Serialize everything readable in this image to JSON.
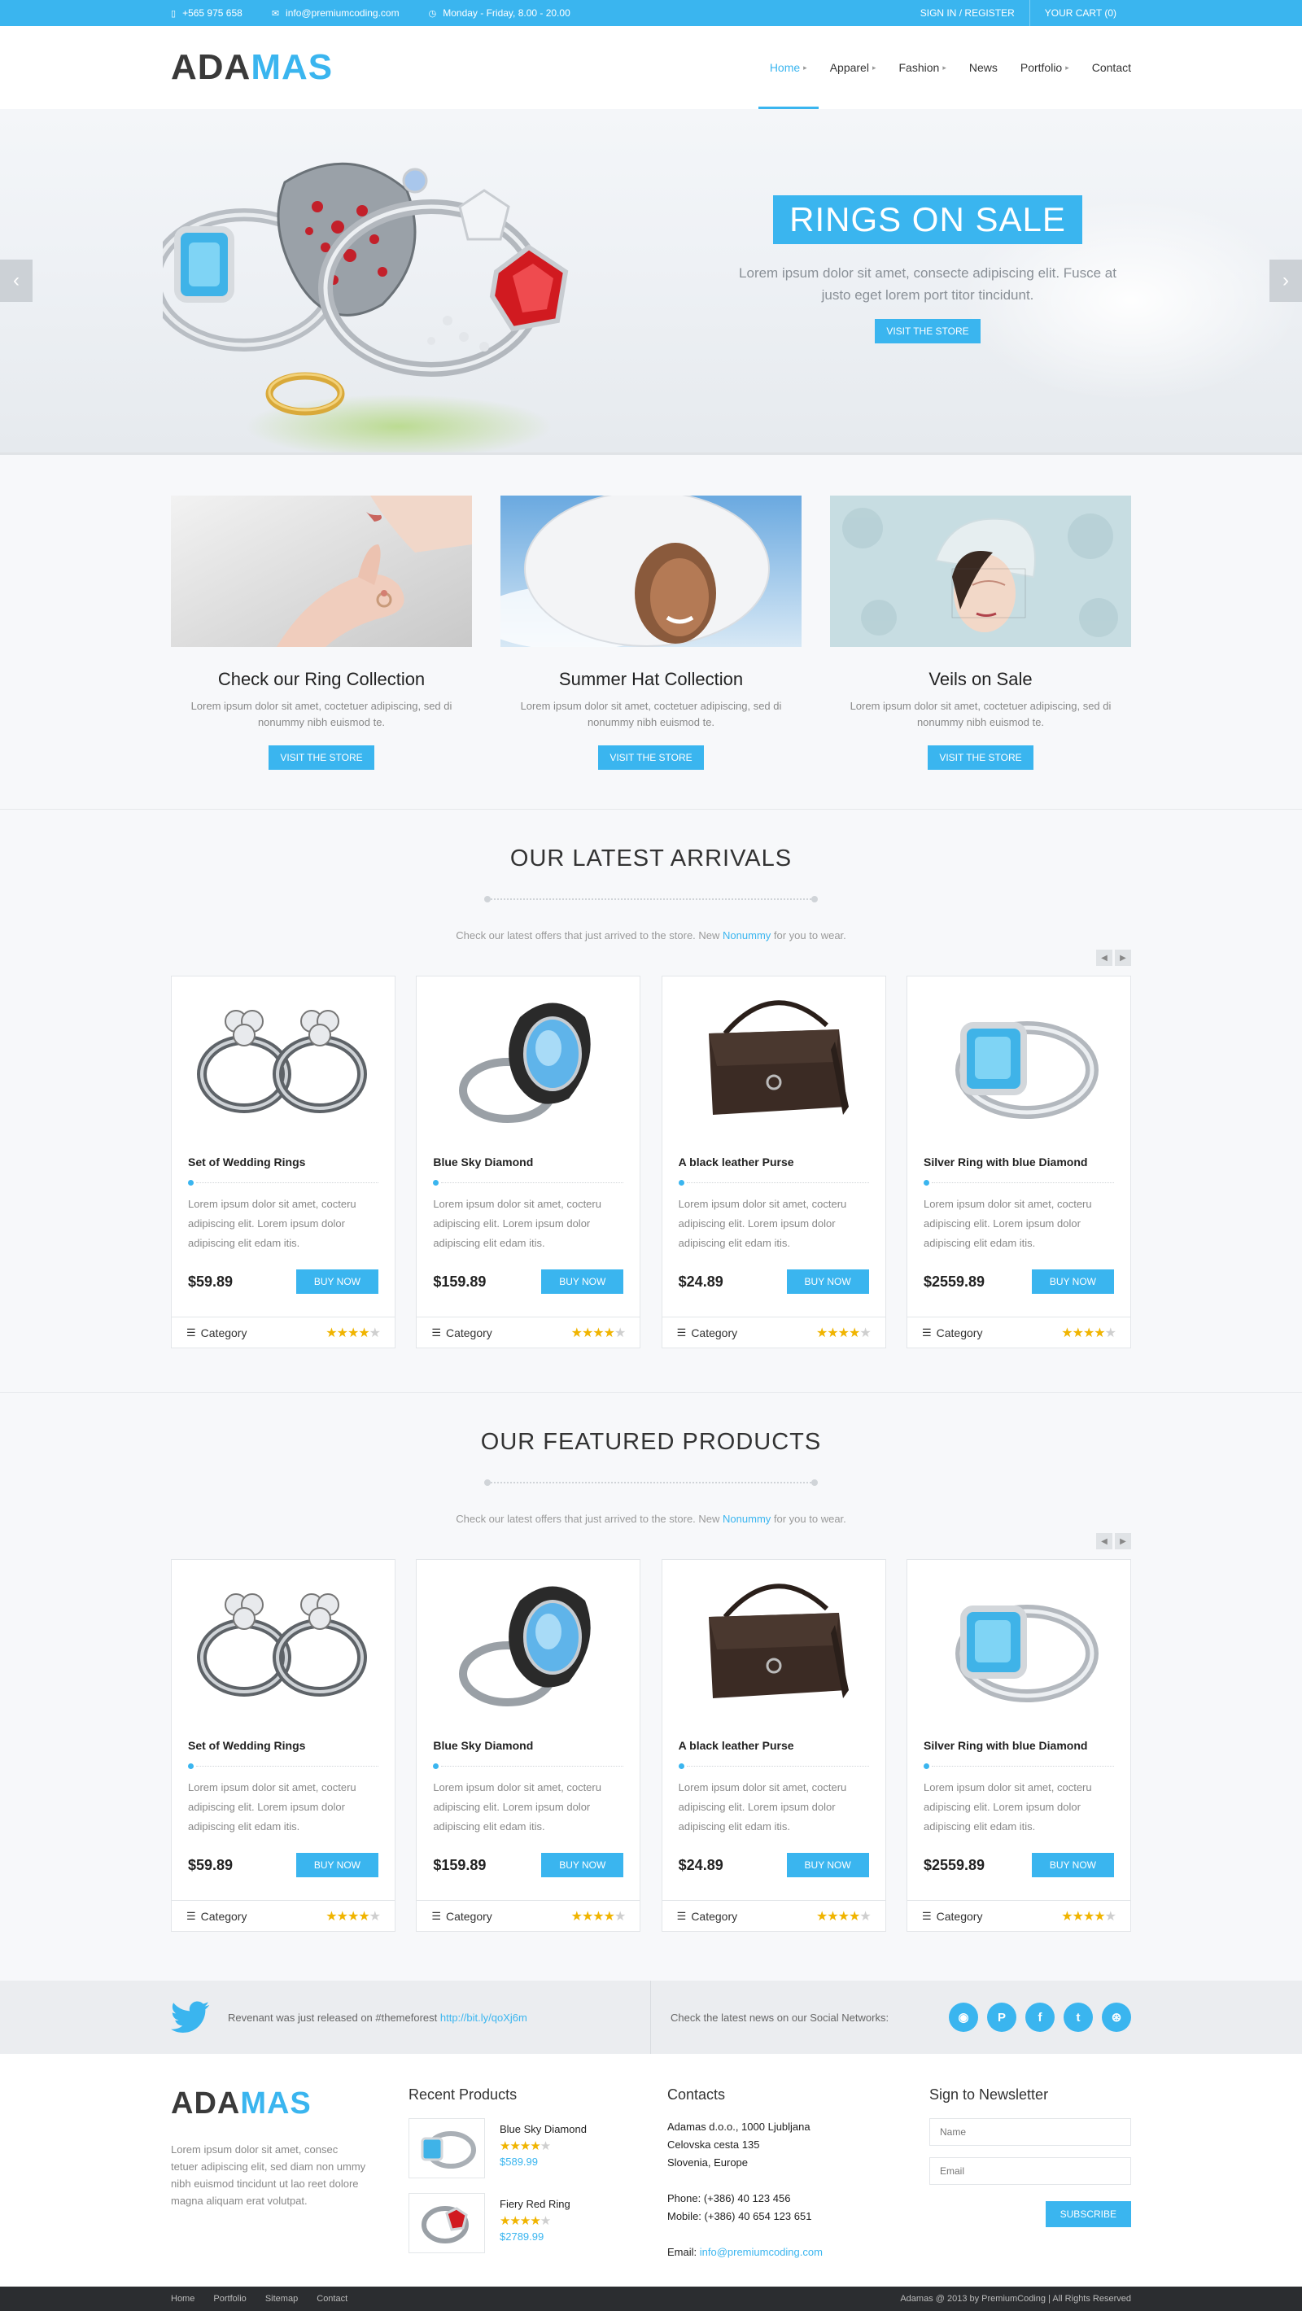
{
  "topbar": {
    "phone": "+565 975 658",
    "email": "info@premiumcoding.com",
    "hours": "Monday - Friday, 8.00 - 20.00",
    "signin": "SIGN IN / REGISTER",
    "cart": "YOUR CART (0)"
  },
  "header": {
    "logo_part1": "ADA",
    "logo_part2": "MAS",
    "nav": [
      "Home",
      "Apparel",
      "Fashion",
      "News",
      "Portfolio",
      "Contact"
    ]
  },
  "hero": {
    "title": "RINGS ON SALE",
    "subtitle": "Lorem ipsum dolor sit amet, consecte adipiscing elit. Fusce at justo eget lorem port titor tincidunt.",
    "button": "VISIT THE STORE"
  },
  "promos": [
    {
      "title": "Check our Ring Collection",
      "text": "Lorem ipsum dolor sit amet, coctetuer adipiscing, sed di nonummy nibh euismod te.",
      "button": "VISIT THE STORE"
    },
    {
      "title": "Summer Hat Collection",
      "text": "Lorem ipsum dolor sit amet, coctetuer adipiscing, sed di nonummy nibh euismod te.",
      "button": "VISIT THE STORE"
    },
    {
      "title": "Veils on Sale",
      "text": "Lorem ipsum dolor sit amet, coctetuer adipiscing, sed di nonummy nibh euismod te.",
      "button": "VISIT THE STORE"
    }
  ],
  "latest": {
    "title": "OUR LATEST ARRIVALS",
    "sub_pre": "Check our latest offers that just arrived to the store. New ",
    "sub_link": "Nonummy",
    "sub_post": " for you to wear."
  },
  "featured": {
    "title": "OUR FEATURED PRODUCTS",
    "sub_pre": "Check our latest offers that just arrived to the store. New ",
    "sub_link": "Nonummy",
    "sub_post": " for you to wear."
  },
  "products": [
    {
      "name": "Set of Wedding Rings",
      "desc": "Lorem ipsum dolor sit amet, cocteru adipiscing elit. Lorem ipsum dolor adipiscing elit edam itis.",
      "price": "$59.89",
      "button": "BUY NOW",
      "category": "Category",
      "rating": 4
    },
    {
      "name": "Blue Sky Diamond",
      "desc": "Lorem ipsum dolor sit amet, cocteru adipiscing elit. Lorem ipsum dolor adipiscing elit edam itis.",
      "price": "$159.89",
      "button": "BUY NOW",
      "category": "Category",
      "rating": 4
    },
    {
      "name": "A black leather Purse",
      "desc": "Lorem ipsum dolor sit amet, cocteru adipiscing elit. Lorem ipsum dolor adipiscing elit edam itis.",
      "price": "$24.89",
      "button": "BUY NOW",
      "category": "Category",
      "rating": 4
    },
    {
      "name": "Silver Ring with blue Diamond",
      "desc": "Lorem ipsum dolor sit amet, cocteru adipiscing elit. Lorem ipsum dolor adipiscing elit edam itis.",
      "price": "$2559.89",
      "button": "BUY NOW",
      "category": "Category",
      "rating": 4
    }
  ],
  "twitter": {
    "text": "Revenant was just released on #themeforest ",
    "link": "http://bit.ly/qoXj6m",
    "social_text": "Check the latest news on our Social Networks:",
    "icons": [
      "rss-icon",
      "pinterest-icon",
      "facebook-icon",
      "twitter-icon",
      "dribbble-icon"
    ]
  },
  "footer": {
    "about": "Lorem ipsum dolor sit amet, consec tetuer adipiscing elit, sed diam non ummy nibh euismod tincidunt ut lao reet dolore magna aliquam erat volutpat.",
    "recent_title": "Recent Products",
    "recent": [
      {
        "name": "Blue Sky Diamond",
        "price": "$589.99",
        "rating": 4
      },
      {
        "name": "Fiery Red Ring",
        "price": "$2789.99",
        "rating": 4
      }
    ],
    "contacts_title": "Contacts",
    "address1": "Adamas d.o.o., 1000 Ljubljana",
    "address2": "Celovska cesta 135",
    "address3": "Slovenia, Europe",
    "phone": "Phone: (+386) 40 123 456",
    "mobile": "Mobile: (+386) 40 654 123 651",
    "email_label": "Email: ",
    "email": "info@premiumcoding.com",
    "newsletter_title": "Sign to Newsletter",
    "name_placeholder": "Name",
    "email_placeholder": "Email",
    "subscribe": "SUBSCRIBE"
  },
  "bottom": {
    "links": [
      "Home",
      "Portfolio",
      "Sitemap",
      "Contact"
    ],
    "copyright": "Adamas @ 2013 by PremiumCoding | All Rights Reserved"
  },
  "colors": {
    "accent": "#3ab5ef",
    "dark": "#2b2d30",
    "star": "#f0b400"
  }
}
